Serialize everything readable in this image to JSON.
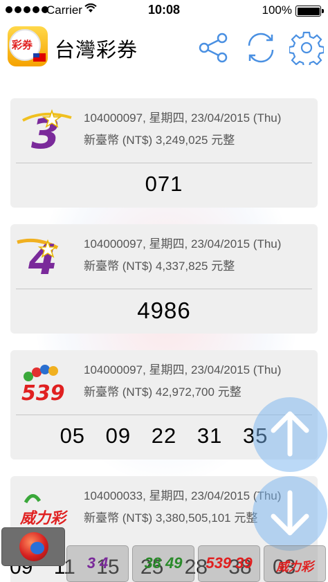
{
  "status_bar": {
    "carrier": "Carrier",
    "time": "10:08",
    "battery": "100%",
    "wifi_icon": "wifi-icon"
  },
  "navbar": {
    "title": "台灣彩券",
    "logo_text": "彩券",
    "icons": [
      "share-icon",
      "refresh-icon",
      "settings-gear-icon"
    ],
    "accent_color": "#4a90e2"
  },
  "cards": [
    {
      "game": "3星彩",
      "logo_glyph": "3",
      "draw_info": "104000097, 星期四, 23/04/2015 (Thu)",
      "prize": "新臺幣 (NT$) 3,249,025 元整",
      "numbers": "071"
    },
    {
      "game": "4星彩",
      "logo_glyph": "4",
      "draw_info": "104000097, 星期四, 23/04/2015 (Thu)",
      "prize": "新臺幣 (NT$) 4,337,825 元整",
      "numbers": "4986"
    },
    {
      "game": "今彩539",
      "logo_glyph": "539",
      "draw_info": "104000097, 星期四, 23/04/2015 (Thu)",
      "prize": "新臺幣 (NT$) 42,972,700 元整",
      "numbers": "05 09 22 31 35"
    },
    {
      "game": "威力彩",
      "logo_glyph": "威力彩",
      "draw_info": "104000033, 星期四, 23/04/2015 (Thu)",
      "prize": "新臺幣 (NT$) 3,380,505,101 元整",
      "numbers": ""
    }
  ],
  "scroll": {
    "up_icon": "arrow-up-icon",
    "down_icon": "arrow-down-icon"
  },
  "tab_bar": {
    "partial_numbers": "09 11 15 25 28 38 03",
    "tabs": [
      {
        "label": "home",
        "glyph": ""
      },
      {
        "label": "3 4",
        "glyph": "3 4"
      },
      {
        "label": "38 49",
        "glyph": "38 49"
      },
      {
        "label": "539 39",
        "glyph": "539 39"
      },
      {
        "label": "威力彩",
        "glyph": "威力彩"
      }
    ]
  }
}
